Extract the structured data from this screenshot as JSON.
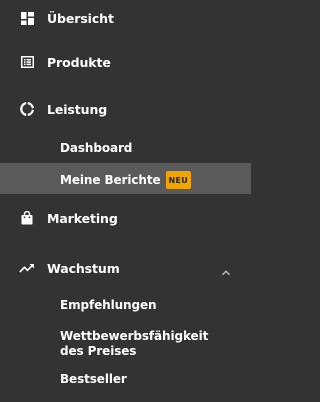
{
  "nav": {
    "overview": {
      "label": "Übersicht",
      "icon": "dashboard-icon"
    },
    "products": {
      "label": "Produkte",
      "icon": "list-icon"
    },
    "performance": {
      "label": "Leistung",
      "icon": "performance-icon",
      "sub": [
        {
          "label": "Dashboard"
        },
        {
          "label": "Meine Berichte",
          "badge": "NEU"
        }
      ]
    },
    "marketing": {
      "label": "Marketing",
      "icon": "shopping-bag-icon"
    },
    "growth": {
      "label": "Wachstum",
      "icon": "trending-up-icon",
      "sub": [
        {
          "label": "Empfehlungen"
        },
        {
          "label": "Wettbewerbsfähigkeit des Preises"
        },
        {
          "label": "Bestseller"
        }
      ]
    }
  },
  "colors": {
    "background": "#333333",
    "active": "#5a5a5a",
    "badge": "#f0a500",
    "text": "#ffffff"
  }
}
